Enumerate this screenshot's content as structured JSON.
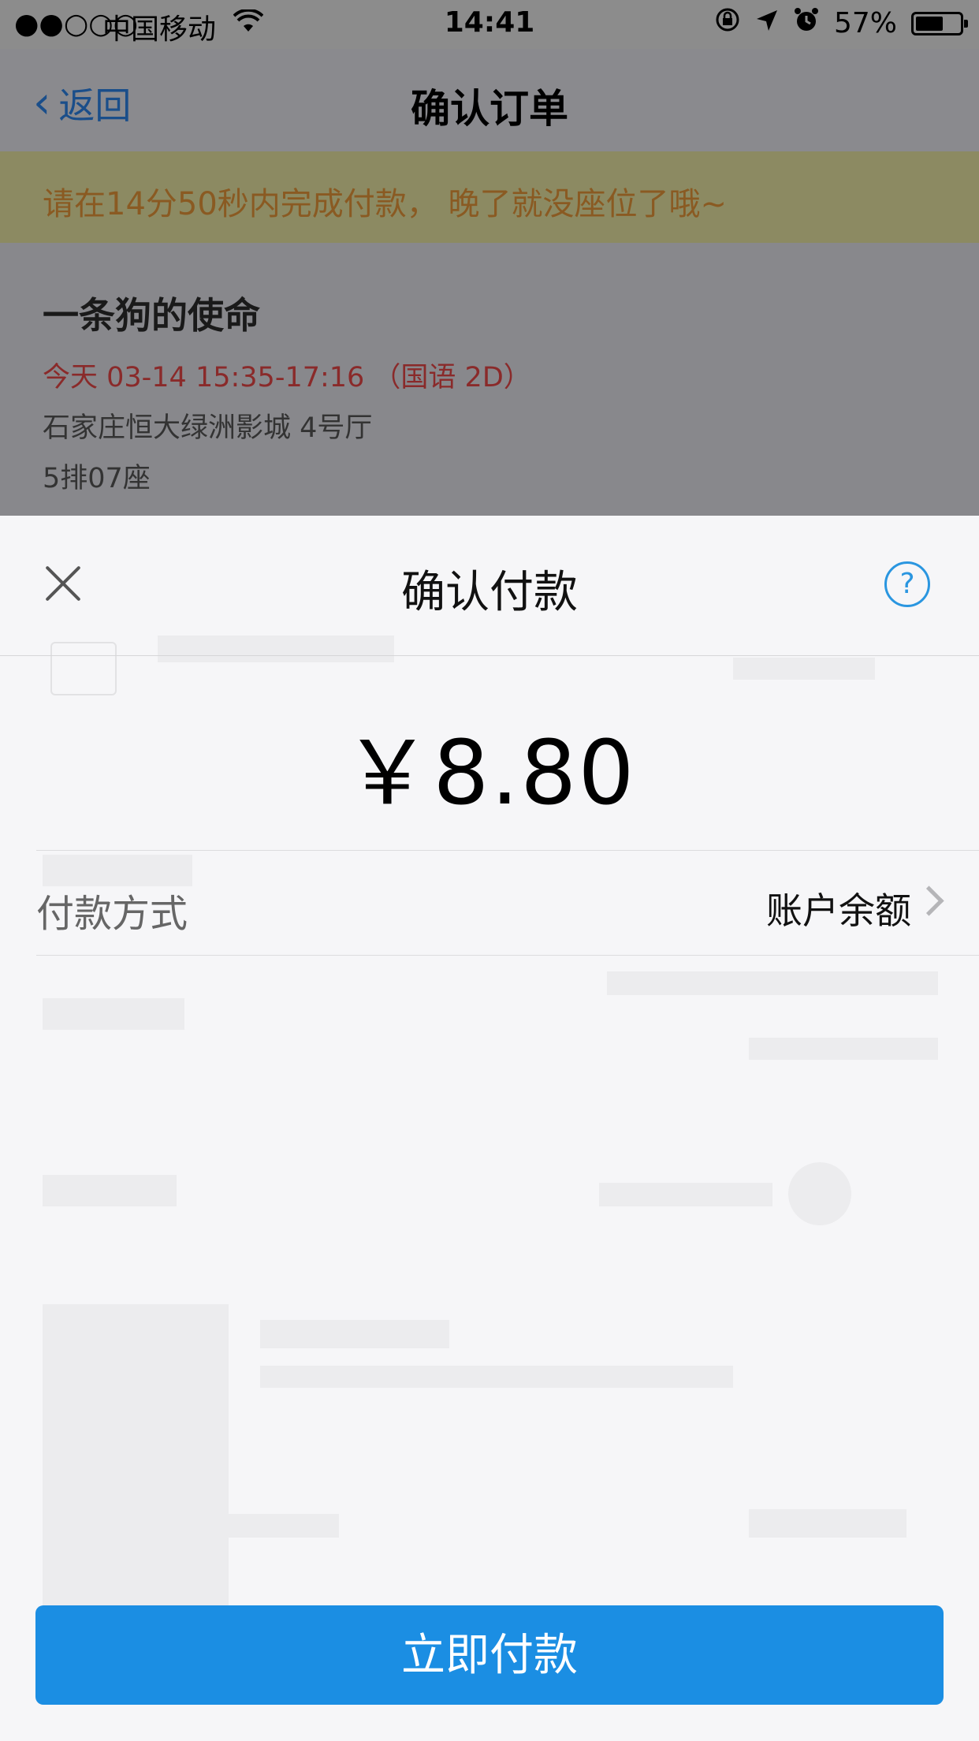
{
  "status_bar": {
    "signal": "●●○○○",
    "carrier": "中国移动",
    "time": "14:41",
    "battery": "57%",
    "battery_level": 0.57
  },
  "nav": {
    "back_label": "返回",
    "title": "确认订单"
  },
  "timer_banner": "请在14分50秒内完成付款， 晚了就没座位了哦~",
  "movie": {
    "name": "一条狗的使命",
    "showtime": "今天 03-14 15:35-17:16 （国语 2D）",
    "cinema": "石家庄恒大绿洲影城 4号厅",
    "seat": "5排07座"
  },
  "payment_sheet": {
    "title": "确认付款",
    "help_symbol": "?",
    "amount": "￥8.80",
    "method_label": "付款方式",
    "method_value": "账户余额",
    "pay_button": "立即付款"
  },
  "colors": {
    "accent": "#1b8ee3",
    "help_icon": "#2a96e0",
    "showtime_text": "#d63c3c",
    "banner_text": "#e07a2a"
  }
}
